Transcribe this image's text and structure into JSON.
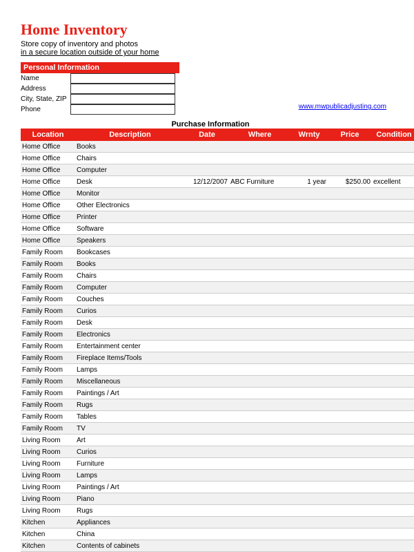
{
  "header": {
    "title": "Home Inventory",
    "subtitle_1": "Store copy of inventory and photos",
    "subtitle_2": "in a secure location outside of your home"
  },
  "personal": {
    "section_label": "Personal Information",
    "fields": [
      {
        "label": "Name",
        "value": ""
      },
      {
        "label": "Address",
        "value": ""
      },
      {
        "label": "City, State, ZIP",
        "value": ""
      },
      {
        "label": "Phone",
        "value": ""
      }
    ]
  },
  "website": "www.mwpublicadjusting.com",
  "purchase_section_title": "Purchase Information",
  "columns": {
    "location": "Location",
    "description": "Description",
    "date": "Date",
    "where": "Where",
    "wrnty": "Wrnty",
    "price": "Price",
    "condition": "Condition"
  },
  "rows": [
    {
      "location": "Home Office",
      "description": "Books",
      "date": "",
      "where": "",
      "wrnty": "",
      "price": "",
      "condition": ""
    },
    {
      "location": "Home Office",
      "description": "Chairs",
      "date": "",
      "where": "",
      "wrnty": "",
      "price": "",
      "condition": ""
    },
    {
      "location": "Home Office",
      "description": "Computer",
      "date": "",
      "where": "",
      "wrnty": "",
      "price": "",
      "condition": ""
    },
    {
      "location": "Home Office",
      "description": "Desk",
      "date": "12/12/2007",
      "where": "ABC Furniture",
      "wrnty": "1 year",
      "price": "$250.00",
      "condition": "excellent"
    },
    {
      "location": "Home Office",
      "description": "Monitor",
      "date": "",
      "where": "",
      "wrnty": "",
      "price": "",
      "condition": ""
    },
    {
      "location": "Home Office",
      "description": "Other Electronics",
      "date": "",
      "where": "",
      "wrnty": "",
      "price": "",
      "condition": ""
    },
    {
      "location": "Home Office",
      "description": "Printer",
      "date": "",
      "where": "",
      "wrnty": "",
      "price": "",
      "condition": ""
    },
    {
      "location": "Home Office",
      "description": "Software",
      "date": "",
      "where": "",
      "wrnty": "",
      "price": "",
      "condition": ""
    },
    {
      "location": "Home Office",
      "description": "Speakers",
      "date": "",
      "where": "",
      "wrnty": "",
      "price": "",
      "condition": ""
    },
    {
      "location": "Family Room",
      "description": "Bookcases",
      "date": "",
      "where": "",
      "wrnty": "",
      "price": "",
      "condition": ""
    },
    {
      "location": "Family Room",
      "description": "Books",
      "date": "",
      "where": "",
      "wrnty": "",
      "price": "",
      "condition": ""
    },
    {
      "location": "Family Room",
      "description": "Chairs",
      "date": "",
      "where": "",
      "wrnty": "",
      "price": "",
      "condition": ""
    },
    {
      "location": "Family Room",
      "description": "Computer",
      "date": "",
      "where": "",
      "wrnty": "",
      "price": "",
      "condition": ""
    },
    {
      "location": "Family Room",
      "description": "Couches",
      "date": "",
      "where": "",
      "wrnty": "",
      "price": "",
      "condition": ""
    },
    {
      "location": "Family Room",
      "description": "Curios",
      "date": "",
      "where": "",
      "wrnty": "",
      "price": "",
      "condition": ""
    },
    {
      "location": "Family Room",
      "description": "Desk",
      "date": "",
      "where": "",
      "wrnty": "",
      "price": "",
      "condition": ""
    },
    {
      "location": "Family Room",
      "description": "Electronics",
      "date": "",
      "where": "",
      "wrnty": "",
      "price": "",
      "condition": ""
    },
    {
      "location": "Family Room",
      "description": "Entertainment center",
      "date": "",
      "where": "",
      "wrnty": "",
      "price": "",
      "condition": ""
    },
    {
      "location": "Family Room",
      "description": "Fireplace Items/Tools",
      "date": "",
      "where": "",
      "wrnty": "",
      "price": "",
      "condition": ""
    },
    {
      "location": "Family Room",
      "description": "Lamps",
      "date": "",
      "where": "",
      "wrnty": "",
      "price": "",
      "condition": ""
    },
    {
      "location": "Family Room",
      "description": "Miscellaneous",
      "date": "",
      "where": "",
      "wrnty": "",
      "price": "",
      "condition": ""
    },
    {
      "location": "Family Room",
      "description": "Paintings / Art",
      "date": "",
      "where": "",
      "wrnty": "",
      "price": "",
      "condition": ""
    },
    {
      "location": "Family Room",
      "description": "Rugs",
      "date": "",
      "where": "",
      "wrnty": "",
      "price": "",
      "condition": ""
    },
    {
      "location": "Family Room",
      "description": "Tables",
      "date": "",
      "where": "",
      "wrnty": "",
      "price": "",
      "condition": ""
    },
    {
      "location": "Family Room",
      "description": "TV",
      "date": "",
      "where": "",
      "wrnty": "",
      "price": "",
      "condition": ""
    },
    {
      "location": "Living Room",
      "description": "Art",
      "date": "",
      "where": "",
      "wrnty": "",
      "price": "",
      "condition": ""
    },
    {
      "location": "Living Room",
      "description": "Curios",
      "date": "",
      "where": "",
      "wrnty": "",
      "price": "",
      "condition": ""
    },
    {
      "location": "Living Room",
      "description": "Furniture",
      "date": "",
      "where": "",
      "wrnty": "",
      "price": "",
      "condition": ""
    },
    {
      "location": "Living Room",
      "description": "Lamps",
      "date": "",
      "where": "",
      "wrnty": "",
      "price": "",
      "condition": ""
    },
    {
      "location": "Living Room",
      "description": "Paintings / Art",
      "date": "",
      "where": "",
      "wrnty": "",
      "price": "",
      "condition": ""
    },
    {
      "location": "Living Room",
      "description": "Piano",
      "date": "",
      "where": "",
      "wrnty": "",
      "price": "",
      "condition": ""
    },
    {
      "location": "Living Room",
      "description": "Rugs",
      "date": "",
      "where": "",
      "wrnty": "",
      "price": "",
      "condition": ""
    },
    {
      "location": "Kitchen",
      "description": "Appliances",
      "date": "",
      "where": "",
      "wrnty": "",
      "price": "",
      "condition": ""
    },
    {
      "location": "Kitchen",
      "description": "China",
      "date": "",
      "where": "",
      "wrnty": "",
      "price": "",
      "condition": ""
    },
    {
      "location": "Kitchen",
      "description": "Contents of cabinets",
      "date": "",
      "where": "",
      "wrnty": "",
      "price": "",
      "condition": ""
    }
  ]
}
